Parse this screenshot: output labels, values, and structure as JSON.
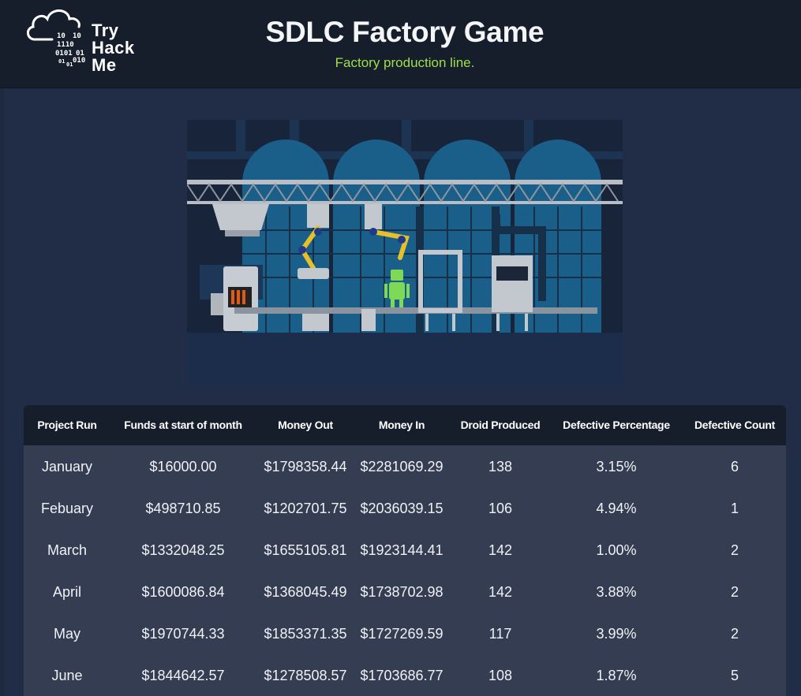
{
  "brand": {
    "logo_words": [
      "Try",
      "Hack",
      "Me"
    ],
    "binary": [
      "10",
      "10",
      "1110",
      "0101",
      "01",
      "01",
      "01",
      "010"
    ]
  },
  "header": {
    "title": "SDLC Factory Game",
    "subtitle": "Factory production line."
  },
  "table": {
    "columns": [
      "Project Run",
      "Funds at start of month",
      "Money Out",
      "Money In",
      "Droid Produced",
      "Defective Percentage",
      "Defective Count"
    ],
    "rows": [
      [
        "January",
        "$16000.00",
        "$1798358.44",
        "$2281069.29",
        "138",
        "3.15%",
        "6"
      ],
      [
        "Febuary",
        "$498710.85",
        "$1202701.75",
        "$2036039.15",
        "106",
        "4.94%",
        "1"
      ],
      [
        "March",
        "$1332048.25",
        "$1655105.81",
        "$1923144.41",
        "142",
        "1.00%",
        "2"
      ],
      [
        "April",
        "$1600086.84",
        "$1368045.49",
        "$1738702.98",
        "142",
        "3.88%",
        "2"
      ],
      [
        "May",
        "$1970744.33",
        "$1853371.35",
        "$1727269.59",
        "117",
        "3.99%",
        "2"
      ],
      [
        "June",
        "$1844642.57",
        "$1278508.57",
        "$1703686.77",
        "108",
        "1.87%",
        "5"
      ]
    ]
  },
  "colors": {
    "header_bg": "#161d2b",
    "page_bg": "#212d46",
    "accent_green": "#9ee04a",
    "table_row_bg": "#343d52"
  }
}
